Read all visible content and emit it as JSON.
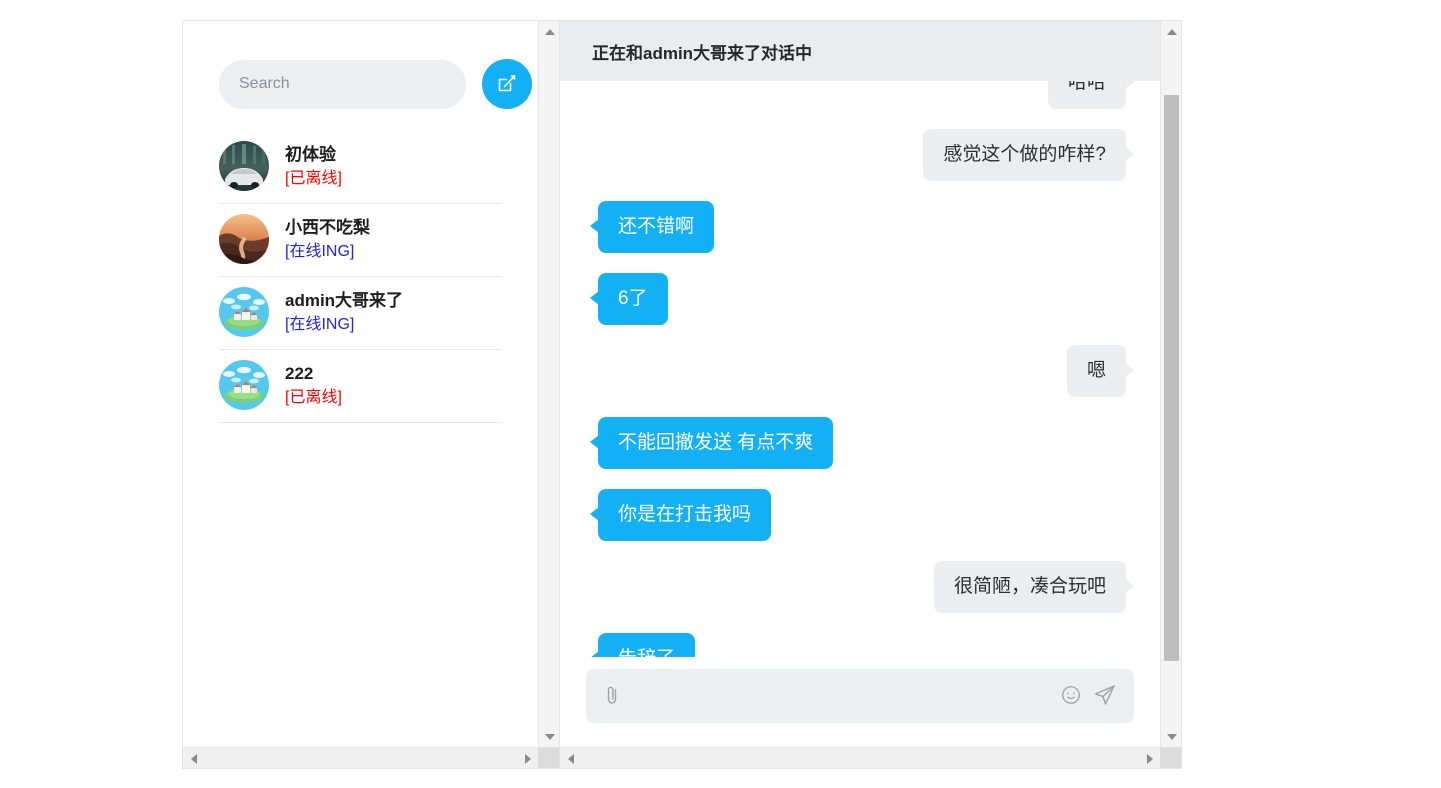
{
  "colors": {
    "accent_blue": "#13b0f5",
    "outgoing_bubble": "#13b0f5",
    "incoming_bubble": "#ebeef0",
    "header_band": "#eaedf0",
    "status_offline": "#ff0000",
    "status_online": "#2323d8"
  },
  "sidebar": {
    "search": {
      "placeholder": "Search",
      "value": ""
    },
    "compose_button": {
      "icon": "compose-edit-icon",
      "label": ""
    },
    "contacts": [
      {
        "name": "初体验",
        "status": "[已离线]",
        "state": "offline",
        "avatar": "photo-car-avatar"
      },
      {
        "name": "小西不吃梨",
        "status": "[在线ING]",
        "state": "online",
        "avatar": "photo-sunset-canyon-avatar"
      },
      {
        "name": "admin大哥来了",
        "status": "[在线ING]",
        "state": "online",
        "avatar": "default-island-avatar"
      },
      {
        "name": "222",
        "status": "[已离线]",
        "state": "offline",
        "avatar": "default-island-avatar"
      }
    ]
  },
  "chat": {
    "header_title": "正在和admin大哥来了对话中",
    "messages": [
      {
        "text": "哈哈",
        "side": "incoming",
        "clipped": true
      },
      {
        "text": "感觉这个做的咋样?",
        "side": "incoming",
        "clipped": false
      },
      {
        "text": "还不错啊",
        "side": "outgoing",
        "clipped": false
      },
      {
        "text": "6了",
        "side": "outgoing",
        "clipped": false
      },
      {
        "text": "嗯",
        "side": "incoming",
        "clipped": false
      },
      {
        "text": "不能回撤发送 有点不爽",
        "side": "outgoing",
        "clipped": false
      },
      {
        "text": "你是在打击我吗",
        "side": "outgoing",
        "clipped": false
      },
      {
        "text": "很简陋，凑合玩吧",
        "side": "incoming",
        "clipped": false
      },
      {
        "text": "告辞了",
        "side": "outgoing",
        "clipped": false
      }
    ],
    "composer": {
      "placeholder": "",
      "value": "",
      "attach_icon": "paperclip-icon",
      "emoji_icon": "smiley-icon",
      "send_icon": "send-paper-plane-icon"
    }
  }
}
